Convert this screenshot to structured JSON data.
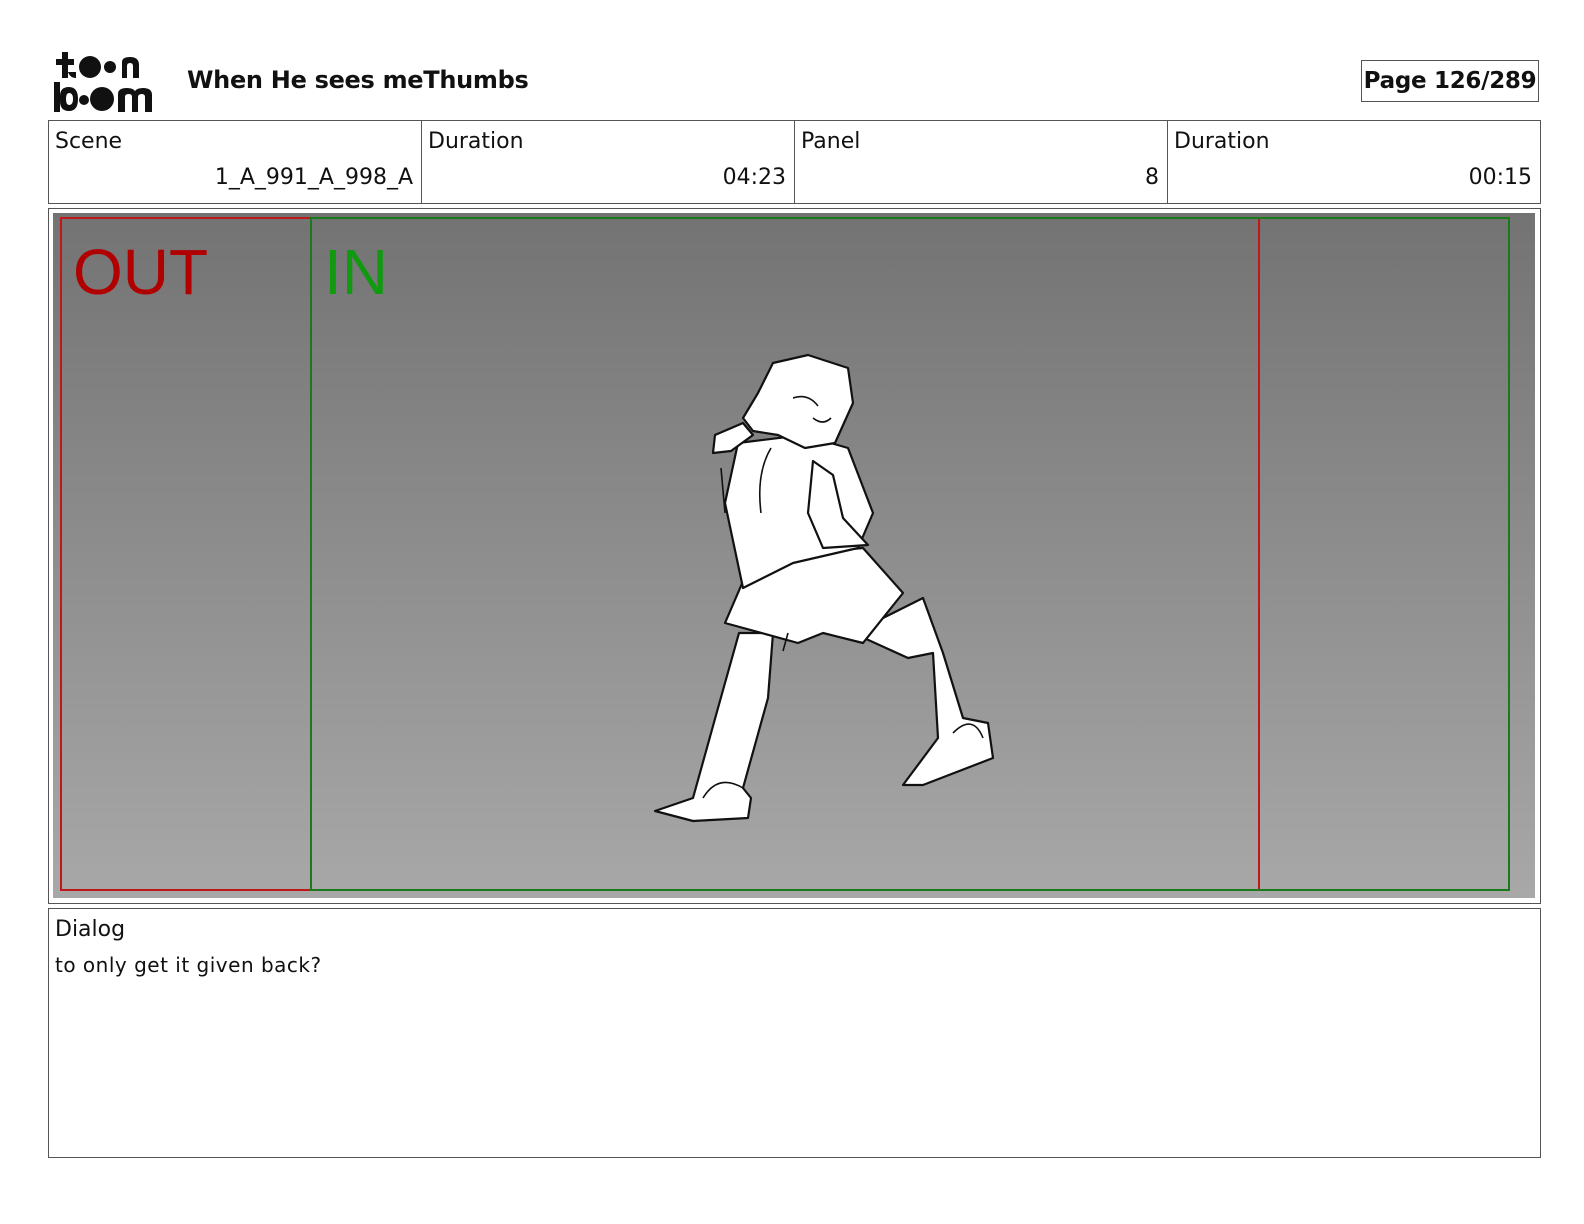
{
  "header": {
    "logo_text": "toon boom",
    "title": "When He sees meThumbs",
    "page": "Page 126/289"
  },
  "info": {
    "scene_label": "Scene",
    "scene_value": "1_A_991_A_998_A",
    "scene_duration_label": "Duration",
    "scene_duration_value": "04:23",
    "panel_label": "Panel",
    "panel_value": "8",
    "panel_duration_label": "Duration",
    "panel_duration_value": "00:15"
  },
  "panel": {
    "out_label": "OUT",
    "in_label": "IN",
    "out_color": "#b00000",
    "in_color": "#119911"
  },
  "dialog": {
    "label": "Dialog",
    "text": "to only get it given back?"
  }
}
